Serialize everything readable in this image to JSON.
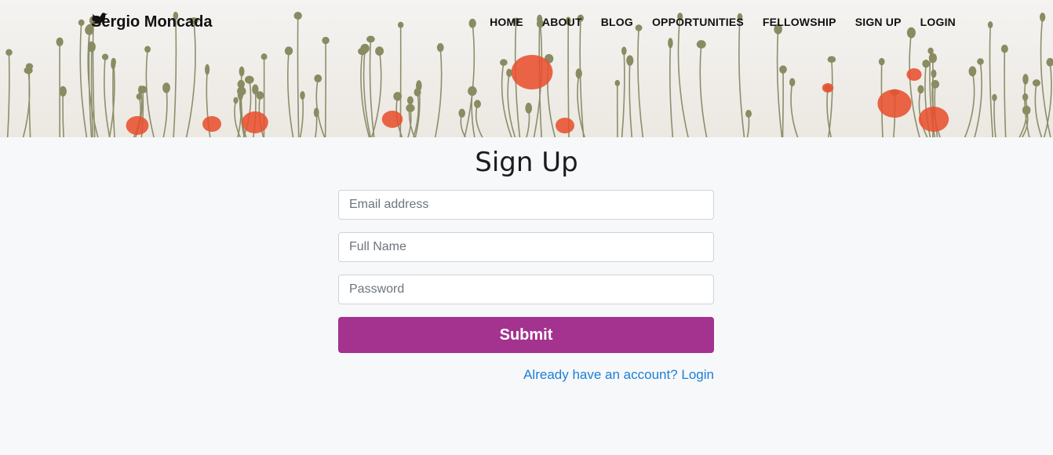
{
  "brand": {
    "name": "Sergio Moncada",
    "icon": "bird-icon"
  },
  "nav": {
    "items": [
      "HOME",
      "ABOUT",
      "BLOG",
      "OPPORTUNITIES",
      "FELLOWSHIP",
      "SIGN UP",
      "LOGIN"
    ]
  },
  "form": {
    "title": "Sign Up",
    "email_placeholder": "Email address",
    "email_value": "",
    "fullname_placeholder": "Full Name",
    "fullname_value": "",
    "password_placeholder": "Password",
    "password_value": "",
    "submit_label": "Submit",
    "login_link": "Already have an account? Login"
  },
  "colors": {
    "accent": "#a3338f",
    "link": "#1a7fd6",
    "background": "#f7f8fa",
    "poppy": "#e8502f"
  }
}
